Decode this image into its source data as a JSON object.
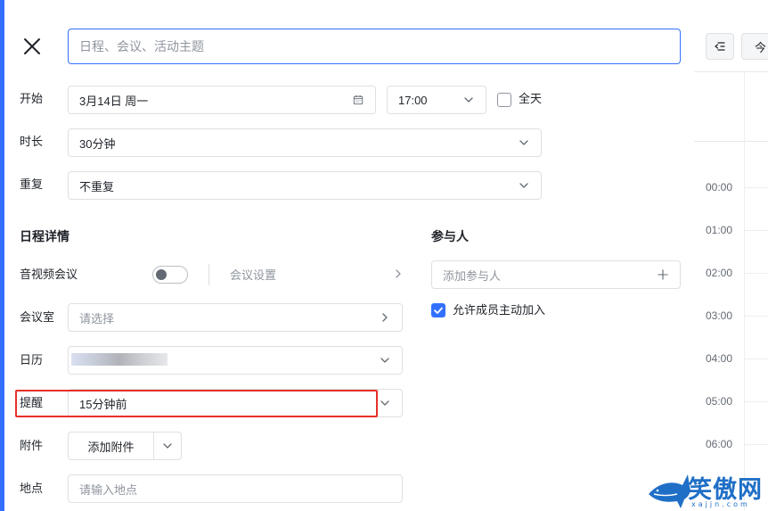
{
  "title_input": {
    "placeholder": "日程、会议、活动主题"
  },
  "start": {
    "label": "开始",
    "date": "3月14日 周一",
    "time": "17:00",
    "allday_label": "全天"
  },
  "duration": {
    "label": "时长",
    "value": "30分钟"
  },
  "repeat": {
    "label": "重复",
    "value": "不重复"
  },
  "details": {
    "section_title": "日程详情",
    "video_meeting": {
      "label": "音视频会议",
      "settings_label": "会议设置"
    },
    "meeting_room": {
      "label": "会议室",
      "placeholder": "请选择"
    },
    "calendar": {
      "label": "日历"
    },
    "reminder": {
      "label": "提醒",
      "value": "15分钟前"
    },
    "attachment": {
      "label": "附件",
      "button_label": "添加附件"
    },
    "location": {
      "label": "地点",
      "placeholder": "请输入地点"
    }
  },
  "participants": {
    "section_title": "参与人",
    "add_placeholder": "添加参与人",
    "allow_join_label": "允许成员主动加入"
  },
  "calendar_pane": {
    "today_label": "今",
    "hours": [
      "00:00",
      "01:00",
      "02:00",
      "03:00",
      "04:00",
      "05:00",
      "06:00"
    ]
  },
  "watermark": {
    "text": "笑傲网",
    "subtext": "xajjn.com"
  },
  "colors": {
    "accent": "#3370ff",
    "highlight": "#e5312a"
  }
}
